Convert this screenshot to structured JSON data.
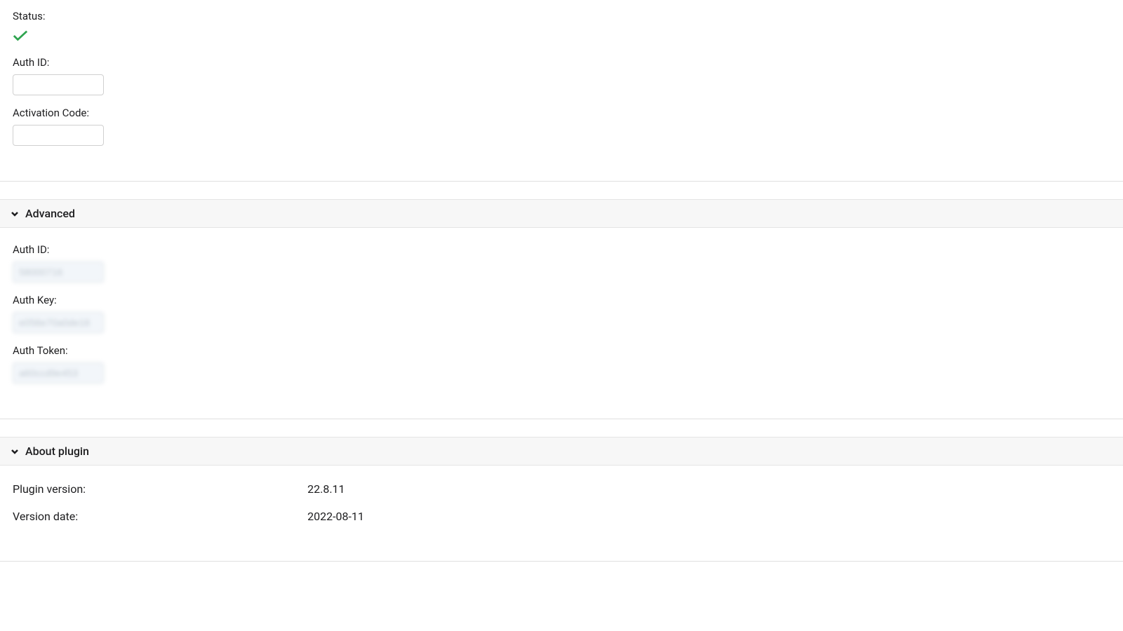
{
  "main": {
    "status_label": "Status:",
    "auth_id_label": "Auth ID:",
    "auth_id_value": "",
    "activation_code_label": "Activation Code:",
    "activation_code_value": ""
  },
  "advanced": {
    "title": "Advanced",
    "auth_id_label": "Auth ID:",
    "auth_id_value": "58000716",
    "auth_key_label": "Auth Key:",
    "auth_key_value": "e056e70a0de16",
    "auth_token_label": "Auth Token:",
    "auth_token_value": "a60ccd9e453"
  },
  "about": {
    "title": "About plugin",
    "plugin_version_label": "Plugin version:",
    "plugin_version_value": "22.8.11",
    "version_date_label": "Version date:",
    "version_date_value": "2022-08-11"
  }
}
